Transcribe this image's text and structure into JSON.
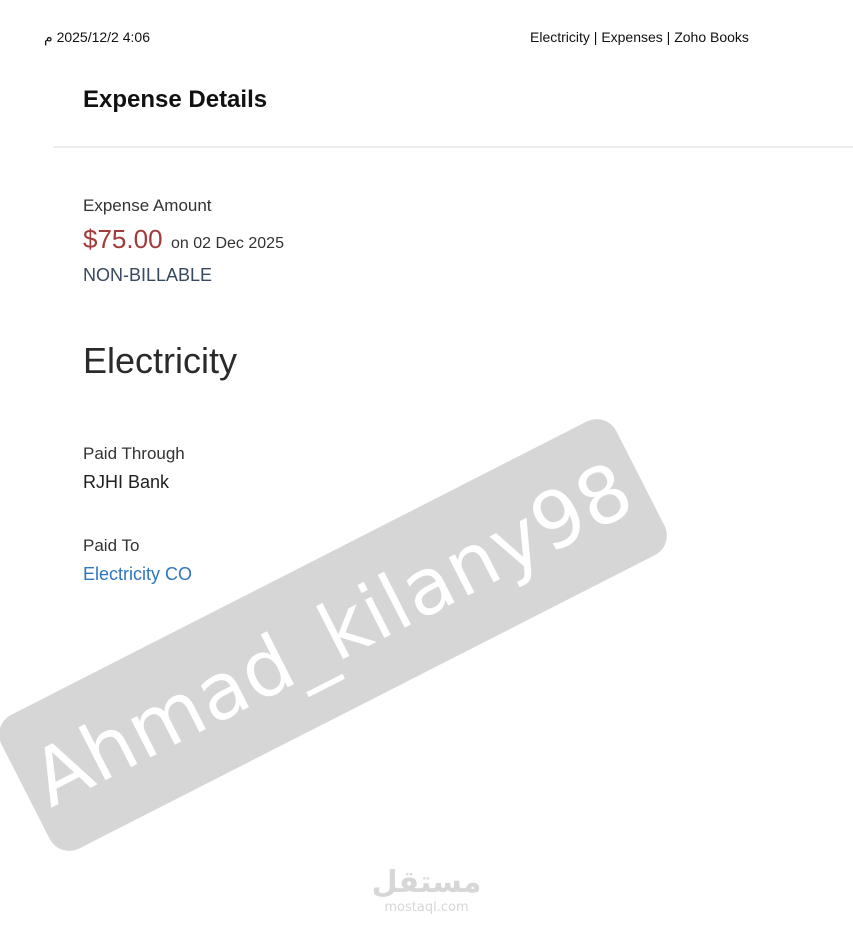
{
  "print_header": {
    "datetime": "4:06 2025/12/2 م",
    "page_title": "Electricity | Expenses | Zoho Books"
  },
  "header": {
    "title": "Expense Details"
  },
  "expense": {
    "amount_label": "Expense Amount",
    "amount": "$75.00",
    "date": "on 02 Dec 2025",
    "billable_status": "NON-BILLABLE",
    "category": "Electricity",
    "paid_through_label": "Paid Through",
    "paid_through": "RJHI Bank",
    "paid_to_label": "Paid To",
    "paid_to": "Electricity CO"
  },
  "overlay": {
    "watermark": "Ahmad_kilany98",
    "brand_logo_ar": "مستقل",
    "brand_logo_en": "mostaql.com"
  },
  "colors": {
    "amount": "#a33a3c",
    "link": "#2f77bd",
    "billable": "#36495f"
  }
}
